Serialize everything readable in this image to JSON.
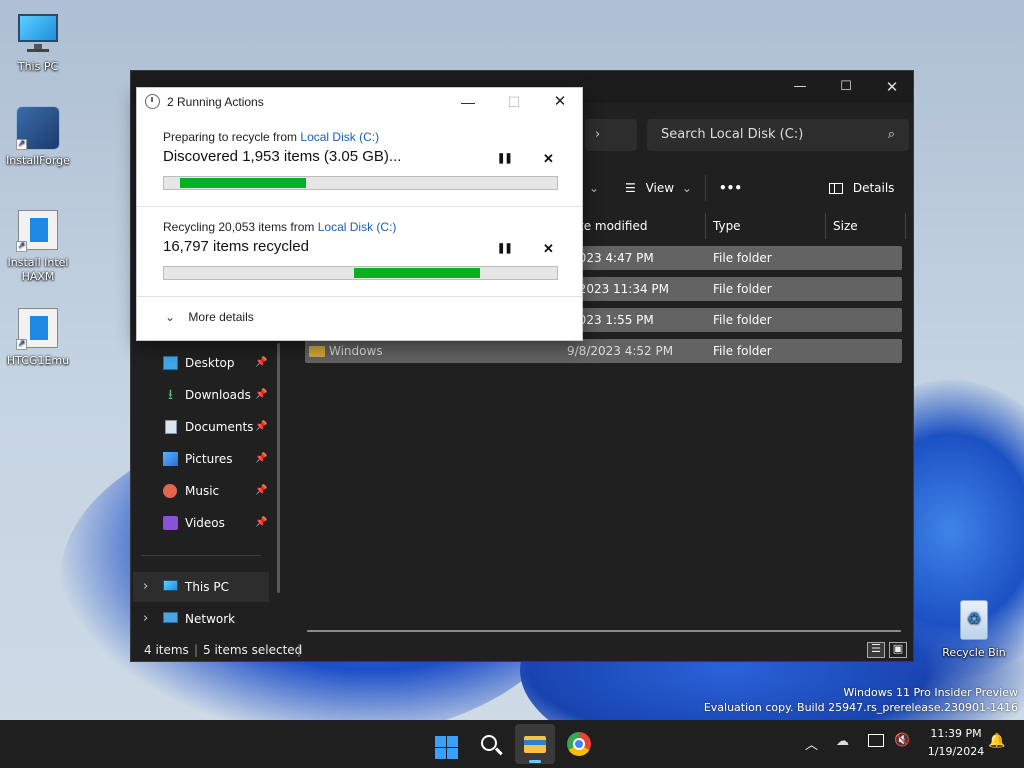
{
  "desktop": {
    "icons": [
      {
        "label": "This PC"
      },
      {
        "label": "InstallForge"
      },
      {
        "label": "Install Intel HAXM"
      },
      {
        "label": "HTCG1Emu"
      },
      {
        "label": "Recycle Bin"
      }
    ],
    "watermark": {
      "line1": "Windows 11 Pro Insider Preview",
      "line2": "Evaluation copy. Build 25947.rs_prerelease.230901-1416"
    }
  },
  "explorer": {
    "search_placeholder": "Search Local Disk (C:)",
    "toolbar": {
      "view_label": "View",
      "more_label": "•••",
      "details_label": "Details"
    },
    "columns": {
      "date": "te modified",
      "type": "Type",
      "size": "Size"
    },
    "files": [
      {
        "name": "",
        "date": "/2023 4:47 PM",
        "type": "File folder"
      },
      {
        "name": "",
        "date": "9/2023 11:34 PM",
        "type": "File folder"
      },
      {
        "name": "",
        "date": "/2023 1:55 PM",
        "type": "File folder"
      },
      {
        "name": "Windows",
        "date": "9/8/2023 4:52 PM",
        "type": "File folder"
      }
    ],
    "nav": [
      {
        "label": "Desktop",
        "icon": "desktop-icon"
      },
      {
        "label": "Downloads",
        "icon": "download-icon"
      },
      {
        "label": "Documents",
        "icon": "documents-icon"
      },
      {
        "label": "Pictures",
        "icon": "pictures-icon"
      },
      {
        "label": "Music",
        "icon": "music-icon"
      },
      {
        "label": "Videos",
        "icon": "videos-icon"
      }
    ],
    "tree": [
      {
        "label": "This PC",
        "icon": "pc-icon"
      },
      {
        "label": "Network",
        "icon": "network-icon"
      }
    ],
    "status": {
      "count": "4 items",
      "selected": "5 items selected"
    }
  },
  "dialog": {
    "title": "2 Running Actions",
    "actions": [
      {
        "prefix": "Preparing to recycle from ",
        "link": "Local Disk (C:)",
        "main": "Discovered 1,953 items (3.05 GB)...",
        "progress": 0.32
      },
      {
        "prefix": "Recycling 20,053 items from ",
        "link": "Local Disk (C:)",
        "main": "16,797 items recycled",
        "progress": 0.32
      }
    ],
    "more_details": "More details",
    "pause_glyph": "❚❚",
    "cancel_glyph": "✕"
  },
  "taskbar": {
    "time": "11:39 PM",
    "date": "1/19/2024",
    "apps": [
      "start-icon",
      "search-icon",
      "file-explorer-icon",
      "chrome-icon"
    ]
  },
  "colors": {
    "progress": "#06b025",
    "accent": "#1a5fb4",
    "dark_bg": "#202020"
  }
}
